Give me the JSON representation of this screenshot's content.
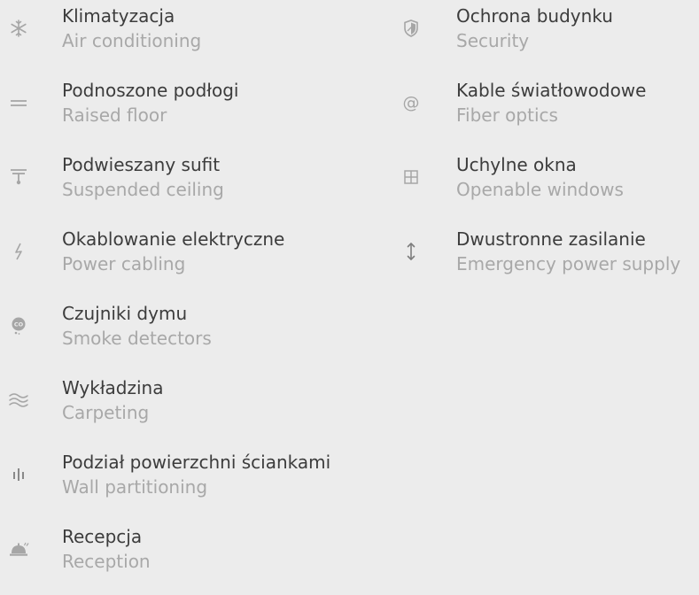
{
  "amenities_left": [
    {
      "label_pl": "Klimatyzacja",
      "label_en": "Air conditioning",
      "icon": "snowflake-icon"
    },
    {
      "label_pl": "Podnoszone podłogi",
      "label_en": "Raised floor",
      "icon": "raised-floor-icon"
    },
    {
      "label_pl": "Podwieszany sufit",
      "label_en": "Suspended ceiling",
      "icon": "suspended-ceiling-icon"
    },
    {
      "label_pl": "Okablowanie elektryczne",
      "label_en": "Power cabling",
      "icon": "lightning-icon"
    },
    {
      "label_pl": "Czujniki dymu",
      "label_en": "Smoke detectors",
      "icon": "smoke-co-icon"
    },
    {
      "label_pl": "Wykładzina",
      "label_en": "Carpeting",
      "icon": "waves-icon"
    },
    {
      "label_pl": "Podział powierzchni ściankami",
      "label_en": "Wall partitioning",
      "icon": "partition-icon"
    },
    {
      "label_pl": "Recepcja",
      "label_en": "Reception",
      "icon": "reception-bell-icon"
    }
  ],
  "amenities_right": [
    {
      "label_pl": "Ochrona budynku",
      "label_en": "Security",
      "icon": "shield-icon"
    },
    {
      "label_pl": "Kable światłowodowe",
      "label_en": "Fiber optics",
      "icon": "at-sign-icon"
    },
    {
      "label_pl": "Uchylne okna",
      "label_en": "Openable windows",
      "icon": "window-icon"
    },
    {
      "label_pl": "Dwustronne zasilanie",
      "label_en": "Emergency power supply",
      "icon": "up-down-arrow-icon"
    }
  ],
  "colors": {
    "background": "#ececec",
    "primary_text": "#3c3c3c",
    "secondary_text": "#a8a8a8",
    "icon": "#a6a6a6"
  }
}
